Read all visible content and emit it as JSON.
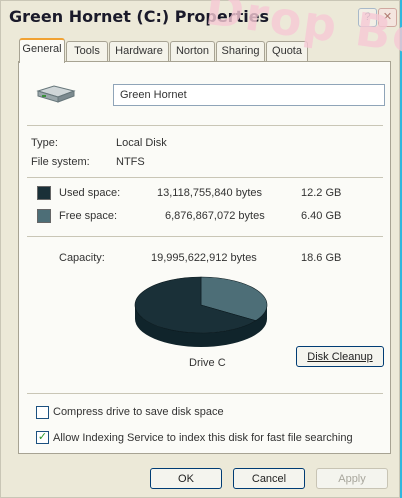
{
  "window": {
    "title": "Green Hornet (C:) Properties",
    "help_label": "?",
    "close_label": "✕"
  },
  "watermark": {
    "text": "Drop Be"
  },
  "tabs": [
    {
      "label": "General",
      "active": true
    },
    {
      "label": "Tools",
      "active": false
    },
    {
      "label": "Hardware",
      "active": false
    },
    {
      "label": "Norton",
      "active": false
    },
    {
      "label": "Sharing",
      "active": false
    },
    {
      "label": "Quota",
      "active": false
    }
  ],
  "drive": {
    "icon": "hard-drive-icon",
    "name": "Green Hornet",
    "type_label": "Type:",
    "type_value": "Local Disk",
    "fs_label": "File system:",
    "fs_value": "NTFS"
  },
  "space": {
    "used": {
      "label": "Used space:",
      "bytes": "13,118,755,840 bytes",
      "size": "12.2 GB",
      "color": "#1a3038"
    },
    "free": {
      "label": "Free space:",
      "bytes": "6,876,867,072 bytes",
      "size": "6.40 GB",
      "color": "#4d6e77"
    },
    "capacity": {
      "label": "Capacity:",
      "bytes": "19,995,622,912 bytes",
      "size": "18.6 GB"
    }
  },
  "chart_data": {
    "type": "pie",
    "title": "",
    "values": [
      12.2,
      6.4
    ],
    "colors": [
      "#1a3038",
      "#4d6e77"
    ]
  },
  "drive_label": "Drive C",
  "disk_cleanup_label": "Disk Cleanup",
  "options": {
    "compress": {
      "label": "Compress drive to save disk space",
      "checked": false
    },
    "index": {
      "label": "Allow Indexing Service to index this disk for fast file searching",
      "checked": true
    }
  },
  "buttons": {
    "ok": "OK",
    "cancel": "Cancel",
    "apply": "Apply"
  }
}
